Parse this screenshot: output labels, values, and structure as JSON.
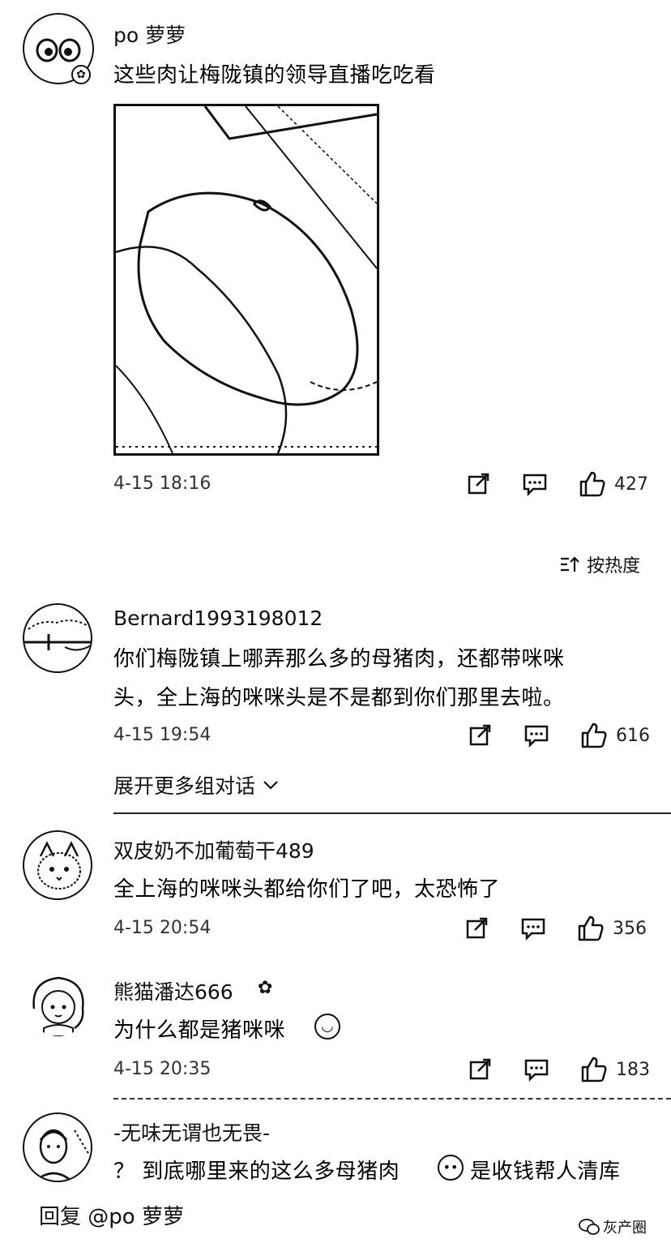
{
  "top_comment": {
    "username": "po 萝萝",
    "text": "这些肉让梅陇镇的领导直播吃吃看",
    "time": "4-15 18:16",
    "likes": "427"
  },
  "sort": {
    "label": "按热度"
  },
  "comments": [
    {
      "username": "Bernard1993198012",
      "text_line1": "你们梅陇镇上哪弄那么多的母猪肉，还都带咪咪",
      "text_line2": "头，全上海的咪咪头是不是都到你们那里去啦。",
      "time": "4-15 19:54",
      "likes": "616"
    },
    {
      "username": "双皮奶不加葡萄干489",
      "text": "全上海的咪咪头都给你们了吧，太恐怖了",
      "time": "4-15 20:54",
      "likes": "356"
    },
    {
      "username": "熊猫潘达666",
      "text": "为什么都是猪咪咪",
      "time": "4-15 20:35",
      "likes": "183"
    },
    {
      "username": "-无味无谓也无畏-",
      "text_a": "？ 到底哪里来的这么多母猪肉",
      "text_b": "是收钱帮人清库"
    }
  ],
  "expand": {
    "label": "展开更多组对话"
  },
  "reply_bar": {
    "label": "回复 @po 萝萝"
  },
  "watermark": {
    "text": "灰产圈"
  },
  "icons": {
    "share": "share-icon",
    "reply": "comment-icon",
    "like": "thumbs-up-icon",
    "sort": "sort-icon",
    "chevron": "chevron-down-icon"
  }
}
